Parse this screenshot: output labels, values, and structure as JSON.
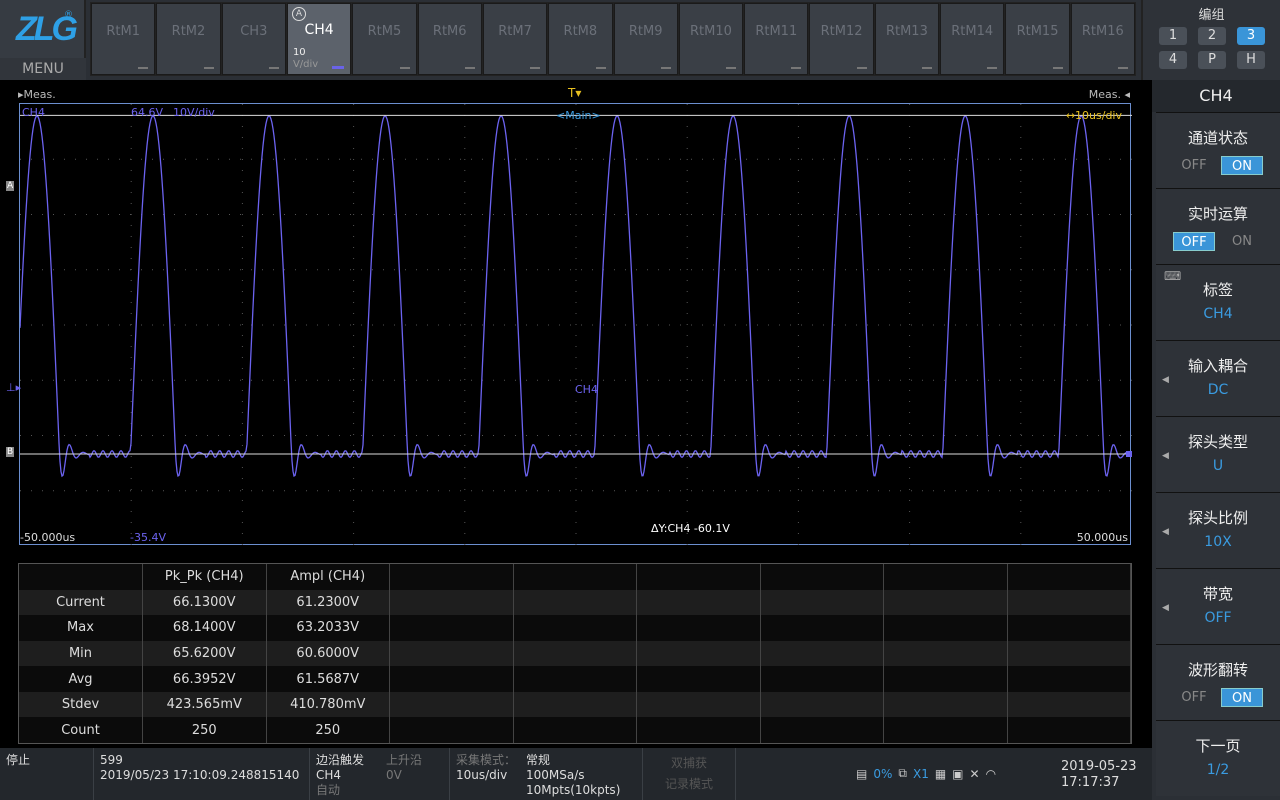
{
  "header": {
    "logo": "ZLG",
    "menu": "MENU",
    "channels": [
      {
        "label": "RtM1"
      },
      {
        "label": "RtM2"
      },
      {
        "label": "CH3"
      },
      {
        "label": "CH4",
        "active": true,
        "scale": "10",
        "unit": "V/div",
        "badge": "A"
      },
      {
        "label": "RtM5"
      },
      {
        "label": "RtM6"
      },
      {
        "label": "RtM7"
      },
      {
        "label": "RtM8"
      },
      {
        "label": "RtM9"
      },
      {
        "label": "RtM10"
      },
      {
        "label": "RtM11"
      },
      {
        "label": "RtM12"
      },
      {
        "label": "RtM13"
      },
      {
        "label": "RtM14"
      },
      {
        "label": "RtM15"
      },
      {
        "label": "RtM16"
      }
    ],
    "group": {
      "title": "编组",
      "buttons": [
        "1",
        "2",
        "3",
        "4",
        "P",
        "H"
      ],
      "selected": "3"
    }
  },
  "scope": {
    "meas_left": "Meas.",
    "meas_right": "Meas.",
    "channel": "CH4",
    "offset": "64.6V",
    "vscale": "10V/div",
    "timebase_label": "<Main>",
    "hscale": "↔10us/div",
    "trace_label": "CH4",
    "cursor_a": "A",
    "cursor_b": "B",
    "delta": "ΔY:CH4 -60.1V",
    "x_min": "-50.000us",
    "x_max": "50.000us",
    "y_bottom": "-35.4V",
    "trace_color": "#6c63f0"
  },
  "chart_data": {
    "type": "line",
    "series": [
      {
        "name": "CH4",
        "shape": "pulse train",
        "period_us": 9.4,
        "peak_v": 61.2,
        "base_v": 0,
        "pulse_width_us": 3.5,
        "ringing": true
      }
    ],
    "xlim": [
      -50,
      50
    ],
    "xunit": "us",
    "vdiv": 10,
    "grid": true,
    "cursor_a_v": 60.1,
    "cursor_b_v": 0
  },
  "table": {
    "headers": [
      "",
      "Pk_Pk (CH4)",
      "Ampl (CH4)"
    ],
    "rows": [
      [
        "Current",
        "66.1300V",
        "61.2300V"
      ],
      [
        "Max",
        "68.1400V",
        "63.2033V"
      ],
      [
        "Min",
        "65.6200V",
        "60.6000V"
      ],
      [
        "Avg",
        "66.3952V",
        "61.5687V"
      ],
      [
        "Stdev",
        "423.565mV",
        "410.780mV"
      ],
      [
        "Count",
        "250",
        "250"
      ]
    ]
  },
  "status": {
    "run": "停止",
    "frame": "599",
    "timestamp": "2019/05/23 17:10:09.248815140",
    "trigger_type": "边沿触发",
    "trigger_src": "CH4",
    "trigger_mode": "自动",
    "edge": "上升沿",
    "level": "0V",
    "acq_label": "采集模式：",
    "acq_mode": "常规",
    "timebase": "10us/div",
    "sample_rate": "100MSa/s",
    "memory": "10Mpts(10kpts)",
    "dual1": "双捕获",
    "dual2": "记录模式",
    "ssd": "0%",
    "usb": "X1",
    "date": "2019-05-23",
    "time": "17:17:37"
  },
  "side": {
    "title": "CH4",
    "items": [
      {
        "label": "通道状态",
        "off": "OFF",
        "on": "ON",
        "state": "ON"
      },
      {
        "label": "实时运算",
        "off": "OFF",
        "on": "ON",
        "state": "OFF"
      },
      {
        "label": "标签",
        "value": "CH4"
      },
      {
        "label": "输入耦合",
        "value": "DC"
      },
      {
        "label": "探头类型",
        "value": "U"
      },
      {
        "label": "探头比例",
        "value": "10X"
      },
      {
        "label": "带宽",
        "value": "OFF"
      },
      {
        "label": "波形翻转",
        "off": "OFF",
        "on": "ON",
        "state": "ON"
      },
      {
        "label": "下一页",
        "value": "1/2"
      }
    ]
  }
}
